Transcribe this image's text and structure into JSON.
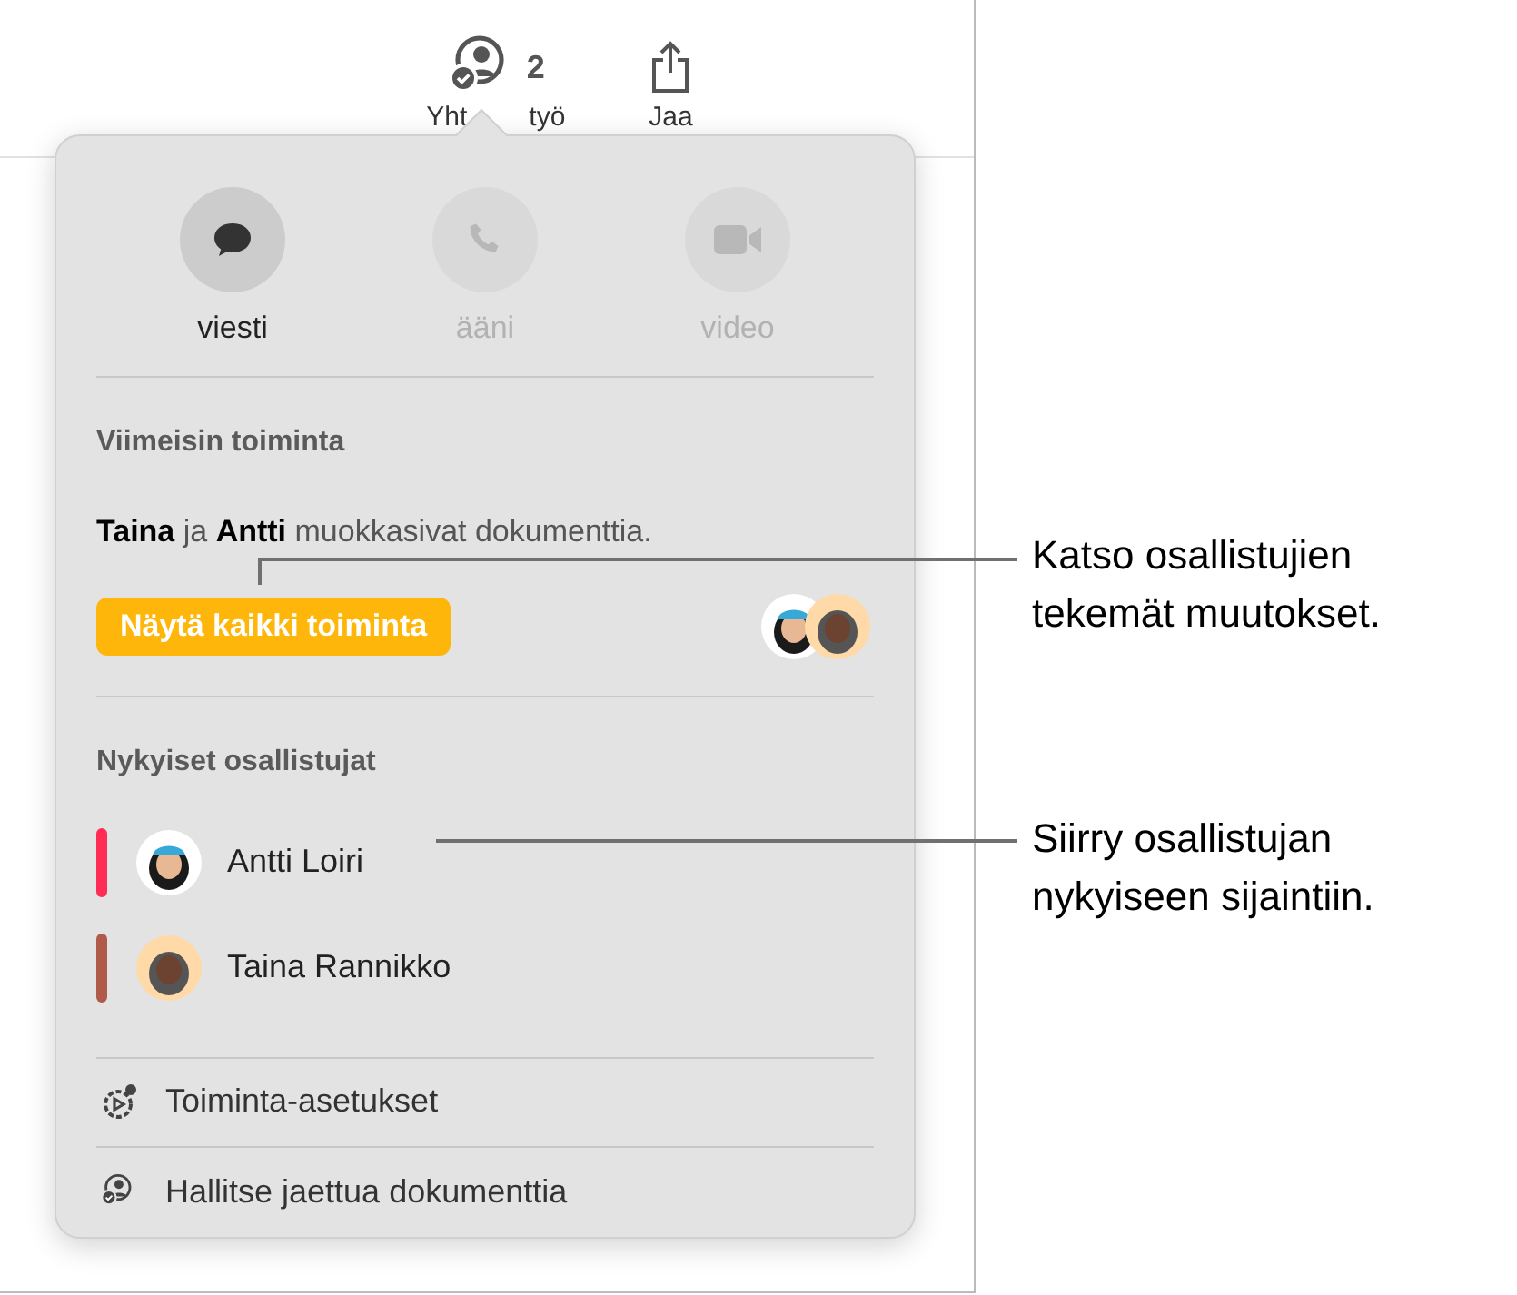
{
  "toolbar": {
    "items": [
      {
        "kind": "collaborate",
        "count": "2",
        "label_parts": [
          "Yht",
          "työ"
        ]
      },
      {
        "kind": "share",
        "label": "Jaa"
      }
    ]
  },
  "popover": {
    "actions": [
      {
        "kind": "message",
        "label": "viesti",
        "disabled": false
      },
      {
        "kind": "phone",
        "label": "ääni",
        "disabled": true
      },
      {
        "kind": "video",
        "label": "video",
        "disabled": true
      }
    ],
    "recent_activity": {
      "heading": "Viimeisin toiminta",
      "summary": "**Taina** ja **Antti** muokkasivat dokumenttia.",
      "button": "Näytä kaikki toiminta"
    },
    "participants": {
      "heading": "Nykyiset osallistujat",
      "items": [
        {
          "name": "Antti Loiri",
          "color": "#ff2d55"
        },
        {
          "name": "Taina Rannikko",
          "color": "#b05a4a"
        }
      ]
    },
    "menu": [
      {
        "kind": "settings",
        "label": "Toiminta-asetukset"
      },
      {
        "kind": "manage",
        "label": "Hallitse jaettua dokumenttia"
      }
    ]
  },
  "callouts": [
    {
      "text": "Katso osallistujien tekemät muutokset."
    },
    {
      "text": "Siirry osallistujan nykyiseen sijaintiin."
    }
  ]
}
